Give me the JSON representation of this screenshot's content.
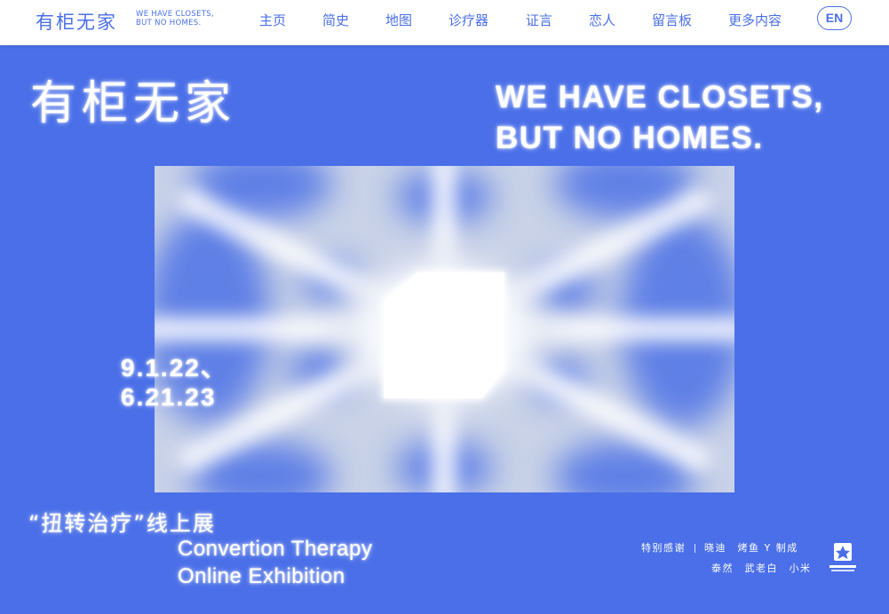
{
  "nav": {
    "logo_cn": "有柜无家",
    "logo_en_line1": "WE HAVE CLOSETS,",
    "logo_en_line2": "BUT NO HOMES.",
    "items": [
      {
        "label": "主页"
      },
      {
        "label": "简史"
      },
      {
        "label": "地图"
      },
      {
        "label": "诊疗器"
      },
      {
        "label": "证言"
      },
      {
        "label": "恋人"
      },
      {
        "label": "留言板"
      },
      {
        "label": "更多内容"
      }
    ],
    "lang_button": "EN"
  },
  "hero": {
    "title_cn": "有柜无家",
    "title_en_line1": "WE HAVE CLOSETS,",
    "title_en_line2": "BUT NO HOMES.",
    "date_line1": "9.1.22、",
    "date_line2": "6.21.23"
  },
  "exhibition": {
    "title_cn": "“扭转治疗”线上展",
    "title_en_line1": "Convertion Therapy",
    "title_en_line2": "Online Exhibition"
  },
  "credits": {
    "label": "特别感谢",
    "names_row1": "晓迪　烤鱼 Y 制成",
    "names_row2": "泰然　武老白　小米"
  },
  "colors": {
    "background": "#4a6fe8",
    "nav_background": "#ffffff",
    "accent": "#4a6fe8"
  }
}
